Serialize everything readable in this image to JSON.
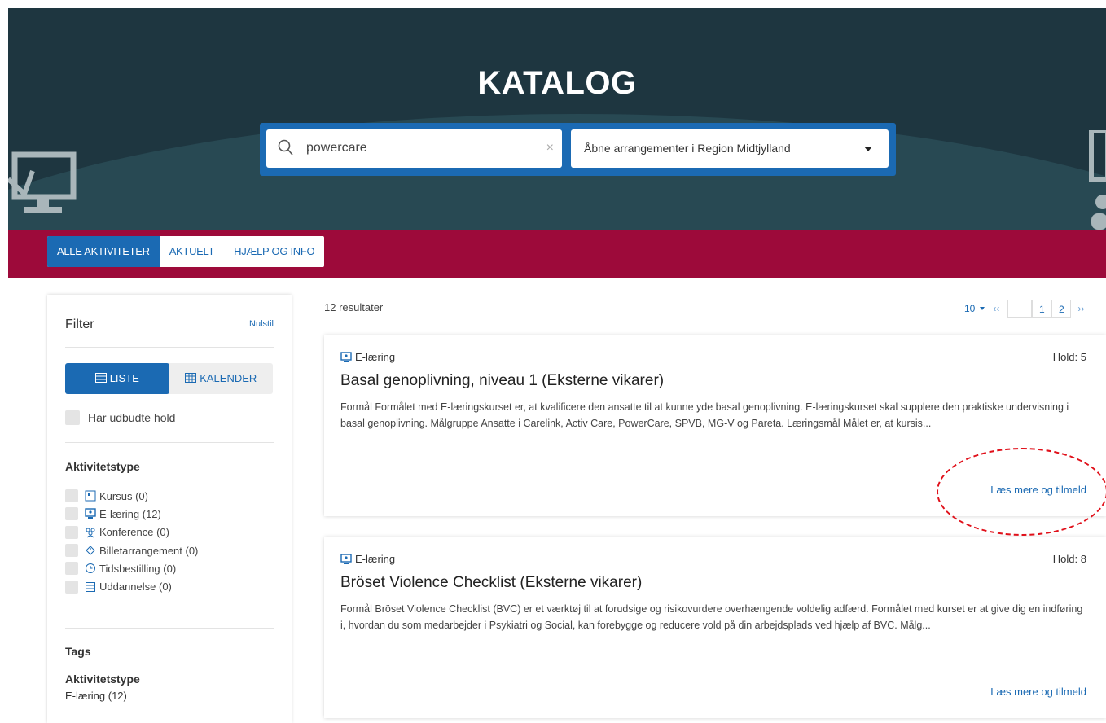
{
  "header": {
    "title": "KATALOG",
    "search": {
      "value": "powercare",
      "clear": "×"
    },
    "select": {
      "value": "Åbne arrangementer i Region Midtjylland"
    }
  },
  "nav": {
    "tabs": [
      {
        "label": "ALLE AKTIVITETER",
        "active": true
      },
      {
        "label": "AKTUELT"
      },
      {
        "label": "HJÆLP OG INFO"
      }
    ]
  },
  "sidebar": {
    "title": "Filter",
    "reset": "Nulstil",
    "view": {
      "list": "LISTE",
      "calendar": "KALENDER"
    },
    "has_offered": "Har udbudte hold",
    "activity_type_title": "Aktivitetstype",
    "activity_types": [
      {
        "label": "Kursus (0)",
        "icon": "course-icon"
      },
      {
        "label": "E-læring (12)",
        "icon": "elearning-icon"
      },
      {
        "label": "Konference (0)",
        "icon": "conference-icon"
      },
      {
        "label": "Billetarrangement (0)",
        "icon": "ticket-icon"
      },
      {
        "label": "Tidsbestilling (0)",
        "icon": "clock-icon"
      },
      {
        "label": "Uddannelse (0)",
        "icon": "education-icon"
      }
    ],
    "tags_title": "Tags",
    "tags_group": "Aktivitetstype",
    "tags_value": "E-læring (12)"
  },
  "results": {
    "count": "12 resultater",
    "per_page": "10",
    "prev": "‹‹",
    "next": "››",
    "pages": [
      "1",
      "2"
    ]
  },
  "cards": [
    {
      "type": "E-læring",
      "hold": "Hold: 5",
      "title": "Basal genoplivning, niveau 1 (Eksterne vikarer)",
      "desc": "Formål Formålet med E-læringskurset er, at kvalificere den ansatte til at kunne yde basal genoplivning. E-læringskurset skal supplere den praktiske undervisning i basal genoplivning. Målgruppe Ansatte i Carelink, Activ Care, PowerCare, SPVB, MG-V og Pareta. Læringsmål Målet er, at kursis...",
      "more": "Læs mere og tilmeld"
    },
    {
      "type": "E-læring",
      "hold": "Hold: 8",
      "title": "Bröset Violence Checklist (Eksterne vikarer)",
      "desc": "Formål Bröset Violence Checklist (BVC) er et værktøj til at forudsige og risikovurdere overhængende voldelig adfærd. Formålet med kurset er at give dig en indføring i, hvordan du som medarbejder i Psykiatri og Social, kan forebygge og reducere vold på din arbejdsplads ved hjælp af BVC. Målg...",
      "more": "Læs mere og tilmeld"
    }
  ],
  "colors": {
    "header_bg": "#1e3640",
    "nav_bg": "#9d0a3a",
    "accent": "#1b6ab3",
    "annotation": "#e0101a"
  }
}
